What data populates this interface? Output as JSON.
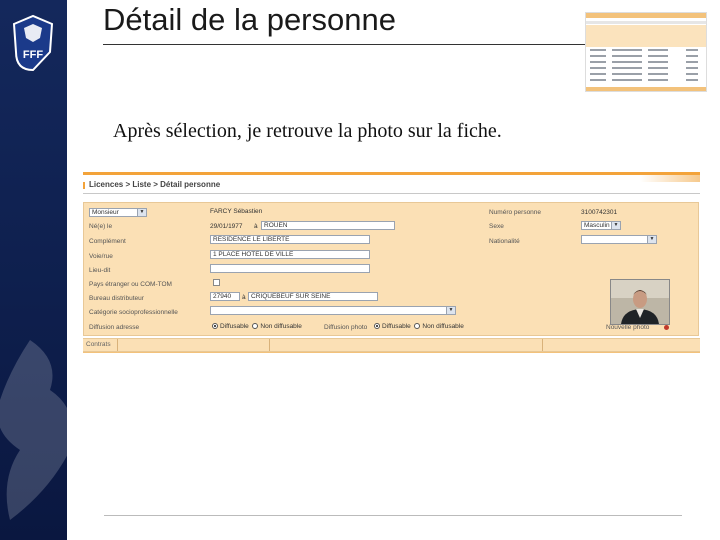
{
  "slide": {
    "title": "Détail de la personne",
    "caption": "Après sélection, je retrouve la photo sur la fiche."
  },
  "brand": {
    "logo_text": "FFF",
    "sidebar_color": "#14285c",
    "accent": "#f3a33a",
    "form_bg": "#fbe0b5"
  },
  "app": {
    "breadcrumb": "Licences > Liste > Détail personne",
    "form": {
      "civility": "Monsieur",
      "name_value": "FARCY Sébastien",
      "numero_label": "Numéro personne",
      "numero_value": "3100742301",
      "naissance_label": "Né(e) le",
      "birth_date": "29/01/1977",
      "birth_a": "à",
      "birth_place": "ROUEN",
      "sexe_label": "Sexe",
      "sexe_value": "Masculin",
      "complement_label": "Complément",
      "complement_value": "RESIDENCE LE LIBERTE",
      "nationalite_label": "Nationalité",
      "voie_label": "Voie/rue",
      "voie_value": "1 PLACE HOTEL DE VILLE",
      "lieudit_label": "Lieu-dit",
      "pays_label": "Pays étranger ou COM-TOM",
      "bureau_label": "Bureau distributeur",
      "cp_value": "27940",
      "bureau_a": "à",
      "commune_value": "CRIQUEBEUF SUR SEINE",
      "categorie_label": "Catégorie socioprofessionnelle",
      "diffusion_label": "Diffusion adresse",
      "diffusable": "Diffusable",
      "non_diffusable": "Non diffusable",
      "diffusion_photo_label": "Diffusion photo",
      "nouvelle_label": "Nouvelle photo"
    },
    "bottom_tab": "Contrats"
  }
}
